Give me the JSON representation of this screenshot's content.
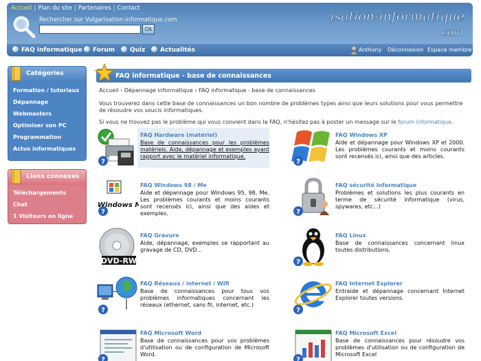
{
  "header": {
    "top_links": [
      "Accueil",
      "Plan du site",
      "Partenaires",
      "Contact"
    ],
    "search_label": "Rechercher sur Vulgarisation-informatique.com",
    "search_value": "",
    "search_button": "Ok",
    "logo_text": "Vulgarisation-informatique",
    "logo_sub": ".com",
    "nav": [
      "FAQ informatique",
      "Forum",
      "Quiz",
      "Actualités"
    ],
    "user": "Anthony",
    "logout": "Déconnexion",
    "member_space": "Espace membre"
  },
  "sidebar": {
    "categories_title": "Catégories",
    "categories": [
      "Formation / tutoriaux",
      "Dépannage",
      "Webmasters",
      "Optimiser son PC",
      "Programmation",
      "Actus informatiques"
    ],
    "links_title": "Liens connexes",
    "links": [
      "Téléchargements",
      "Chat",
      "1 Visiteurs en ligne"
    ]
  },
  "content": {
    "title": "FAQ informatique - base de connaissances",
    "breadcrumb": "Accueil › Dépannage informatique › FAQ informatique - base de connaissances",
    "intro1": "Vous trouverez dans cette base de connaissances un bon nombre de problèmes types ainsi que leurs solutions pour vous permettre de résoudre vos soucis informatiques.",
    "intro2_prefix": "Si vous ne trouvez pas le problème qui vous convient dans la FAQ, n'hésitez pas à poster un message sur le ",
    "intro2_link": "forum informatique",
    "intro2_suffix": ".",
    "faqs": [
      {
        "title": "FAQ Hardware (matériel)",
        "desc": "Base de connaissances pour les problèmes matériels. Aide, dépannage et exemples ayant rapport avec le matériel informatique.",
        "icon": "printer-icon"
      },
      {
        "title": "FAQ Windows XP",
        "desc": "Aide et dépannage pour Windows XP et 2000. Les problèmes courants et moins courants sont recensés ici, ainsi que des articles.",
        "icon": "windows-xp-icon"
      },
      {
        "title": "FAQ Windows 98 / Me",
        "desc": "Aide et dépannage pour Windows 95, 98, Me. Les problèmes courants et moins courants sont recensés ici, ainsi que des aides et exemples.",
        "icon": "windows-me-icon"
      },
      {
        "title": "FAQ sécurité informatique",
        "desc": "Problèmes et solutions les plus courants en terme de sécurité informatique (virus, spywares, etc...)",
        "icon": "padlock-icon"
      },
      {
        "title": "FAQ Gravure",
        "desc": "Aide, dépannage, exemples se rapportant au gravage de CD, DVD...",
        "icon": "cd-rw-icon"
      },
      {
        "title": "FAQ Linux",
        "desc": "Base de connaissances concernant linux toutes distributions.",
        "icon": "linux-penguin-icon"
      },
      {
        "title": "FAQ Réseaux / internet / Wifi",
        "desc": "Base de connaissances pour tous vos problèmes informatiques concernant les réseaux (ethernet, sans fil, internet, etc.)",
        "icon": "network-globe-icon"
      },
      {
        "title": "FAQ Internet Explorer",
        "desc": "Entraide et dépannage concernant Internet Explorer toutes versions.",
        "icon": "internet-explorer-icon"
      },
      {
        "title": "FAQ Microsoft Word",
        "desc": "Base de connaissances pour vos problèmes d'utilisation ou de configuration de Microsoft Word.",
        "icon": "word-document-icon"
      },
      {
        "title": "FAQ Microsoft Excel",
        "desc": "Base de connaissances pour résoudre vos problèmes d'utilisation ou de configuration de Microsoft Excel",
        "icon": "excel-sheet-icon"
      }
    ],
    "cd_label": "DVD-RW",
    "me_label": "Windows Me"
  }
}
